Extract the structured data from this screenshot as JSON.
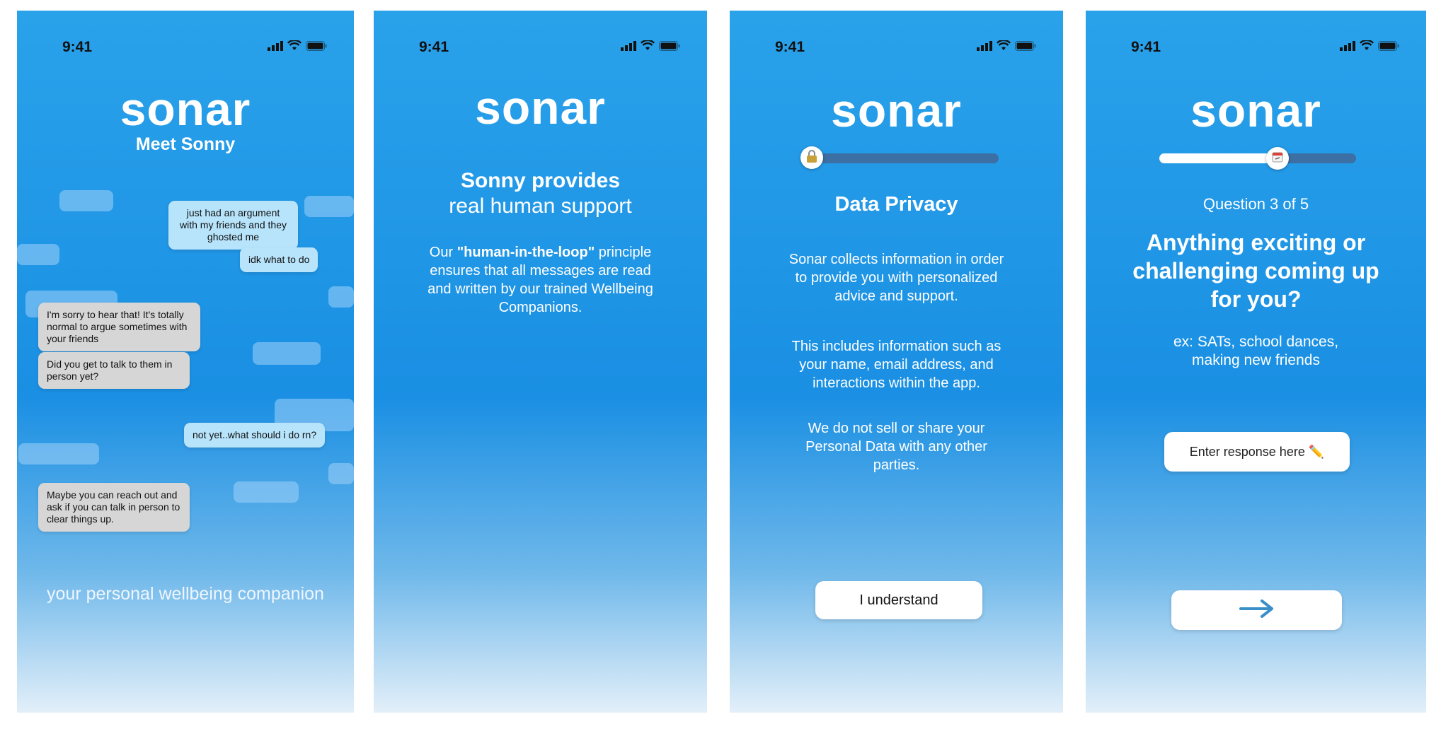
{
  "status_bar": {
    "time": "9:41"
  },
  "brand": {
    "logo": "sonar"
  },
  "screen1": {
    "heading": "Meet Sonny",
    "messages": [
      {
        "from": "user",
        "text": "just had an argument with my friends and they ghosted me"
      },
      {
        "from": "user",
        "text": "idk what to do"
      },
      {
        "from": "sonny",
        "text": "I'm sorry to hear that! It's totally normal to argue sometimes with your friends"
      },
      {
        "from": "sonny",
        "text": "Did you get to talk to them in person yet?"
      },
      {
        "from": "user",
        "text": "not yet..what should i do rn?"
      },
      {
        "from": "sonny",
        "text": "Maybe you can reach out and ask if you can talk in person to clear things up."
      }
    ],
    "tagline": "your personal wellbeing companion"
  },
  "screen2": {
    "title_bold": "Sonny provides",
    "title_light": "real human support",
    "body_prefix": "Our ",
    "body_emphasis": "\"human-in-the-loop\"",
    "body_suffix": " principle ensures that all messages are read and written by our trained Wellbeing Companions."
  },
  "screen3": {
    "progress": 0.0,
    "knob_icon": "lock-icon",
    "title": "Data Privacy",
    "para1": "Sonar collects information in order to provide you with personalized advice and support.",
    "para2": "This includes information such as your name, email address, and interactions within the app.",
    "para3": "We do not sell or share your Personal Data with any other parties.",
    "button": "I understand"
  },
  "screen4": {
    "progress": 0.6,
    "knob_icon": "calendar-icon",
    "counter": "Question 3 of 5",
    "question": "Anything exciting or challenging coming up for you?",
    "hint": "ex: SATs, school dances, making new friends",
    "input_placeholder": "Enter response here ✏️",
    "next_icon": "arrow-right-icon"
  },
  "colors": {
    "gradient_top": "#2aa2ea",
    "gradient_mid": "#1a8fe3",
    "user_bubble": "#b7e4fb",
    "sonny_bubble": "#d6d6d6",
    "progress_track": "#3c6fa3",
    "arrow": "#3a8fc8"
  }
}
